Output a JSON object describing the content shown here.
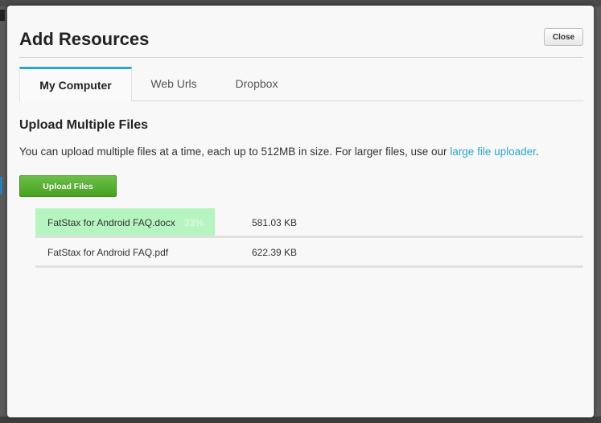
{
  "modal": {
    "title": "Add Resources",
    "close_label": "Close"
  },
  "tabs": [
    {
      "label": "My Computer",
      "active": true
    },
    {
      "label": "Web Urls",
      "active": false
    },
    {
      "label": "Dropbox",
      "active": false
    }
  ],
  "upload": {
    "heading": "Upload Multiple Files",
    "description": "You can upload multiple files at a time, each up to 512MB in size. For larger files, use our ",
    "link_text": "large file uploader",
    "description_end": ".",
    "button_label": "Upload Files"
  },
  "files": [
    {
      "name": "FatStax for Android FAQ.docx",
      "progress_label": "33%",
      "progress_fraction": 0.33,
      "size": "581.03 KB"
    },
    {
      "name": "FatStax for Android FAQ.pdf",
      "progress_label": "",
      "progress_fraction": 0,
      "size": "622.39 KB"
    }
  ],
  "colors": {
    "accent": "#2ba6cb",
    "upload_button": "#5cb236",
    "progress_fill": "#b6f5c0"
  }
}
